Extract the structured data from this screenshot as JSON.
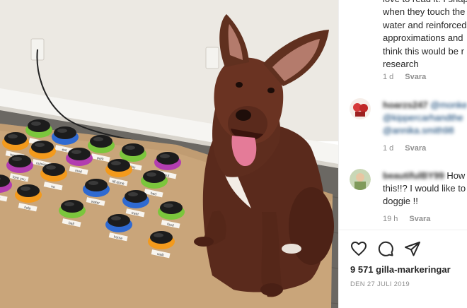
{
  "caption": {
    "text": "love to read it. I shap\nwhen they touch the\nwater and reinforced\napproximations and\nthink this would be r\nresearch",
    "time": "1 d",
    "reply": "Svara"
  },
  "comments": [
    {
      "username": "hoarzs247",
      "text_tags": [
        "@monke",
        "@kippercarhandthe",
        "@annika.smith98"
      ],
      "time": "1 d",
      "reply": "Svara"
    },
    {
      "username": "beautifulBY99",
      "text_line1": "How",
      "text_line2": "this!!? I would like to",
      "text_line3": "doggie !!",
      "time": "19 h",
      "reply": "Svara"
    }
  ],
  "actions": {
    "like_icon": "heart-icon",
    "comment_icon": "comment-icon",
    "share_icon": "share-icon"
  },
  "likes": "9 571 gilla-markeringar",
  "date": "DEN 27 JULI 2019",
  "photo": {
    "button_labels": [
      "walk",
      "eat",
      "park",
      "play",
      "out",
      "happy",
      "outside",
      "mad",
      "all done",
      "bed",
      "love you",
      "no",
      "water",
      "treat",
      "food",
      "help",
      "ball",
      "home"
    ],
    "button_colors": {
      "orange": "#f39a1c",
      "green": "#7bc63c",
      "blue": "#2f6ad1",
      "purple": "#b23db0",
      "top": "#1c1c1c"
    }
  }
}
